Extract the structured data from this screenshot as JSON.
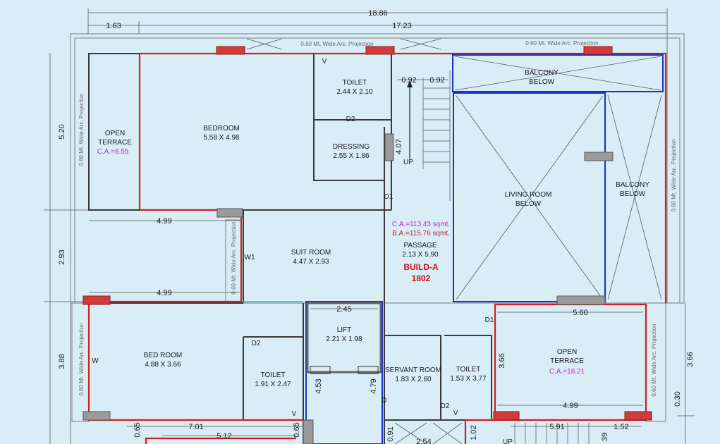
{
  "dimensions": {
    "overall_width": "18.86",
    "left_offset": "1.63",
    "inner_width": "17.23",
    "stair_a": "0.92",
    "stair_b": "0.92",
    "left_h1": "5.20",
    "left_h2": "2.93",
    "left_h3": "3.88",
    "bed_width_1": "4.99",
    "bed_width_2": "4.99",
    "lift_width": "2.45",
    "stair_run": "4.07",
    "right_width_1": "5.60",
    "right_h1": "3.66",
    "right_h2": "3.66",
    "right_width_2": "4.99",
    "right_h3": "0.30",
    "bottom_1": "0.65",
    "bottom_2": "7.01",
    "bottom_3": "5.12",
    "bottom_4": "0.65",
    "bottom_5": "4.53",
    "bottom_6": "4.79",
    "bottom_7": "0.91",
    "bottom_8": "2.54",
    "bottom_9": "1.02",
    "bottom_10": "5.91",
    "bottom_11": "1.52",
    "bottom_12": "39"
  },
  "projection_label": "0.60 Mt. Wide Arc. Projection",
  "rooms": {
    "open_terrace_1": {
      "line1": "OPEN",
      "line2": "TERRACE",
      "ca": "C.A.=8.55"
    },
    "bedroom": {
      "name": "BEDROOM",
      "size": "5.58 X 4.98"
    },
    "toilet_1": {
      "name": "TOILET",
      "size": "2.44 X 2.10"
    },
    "dressing": {
      "name": "DRESSING",
      "size": "2.55 X 1.86"
    },
    "balcony_top": {
      "line1": "BALCONY",
      "line2": "BELOW"
    },
    "living_room": {
      "line1": "LIVING ROOM",
      "line2": "BELOW"
    },
    "balcony_right": {
      "line1": "BALCONY",
      "line2": "BELOW"
    },
    "suit_room": {
      "name": "SUIT ROOM",
      "size": "4.47 X 2.93"
    },
    "passage": {
      "ca": "C.A.=113.43 sqmt.",
      "ba": "B.A.=115.76 sqmt.",
      "name": "PASSAGE",
      "size": "2.13 X 5.90"
    },
    "build": {
      "line1": "BUILD-A",
      "line2": "1802"
    },
    "bed_room": {
      "name": "BED ROOM",
      "size": "4.88 X 3.66"
    },
    "lift": {
      "name": "LIFT",
      "size": "2.21 X 1.98"
    },
    "toilet_2": {
      "name": "TOILET",
      "size": "1.91 X 2.47"
    },
    "servant_room": {
      "name": "SERVANT ROOM",
      "size": "1.83 X 2.60"
    },
    "toilet_3": {
      "name": "TOILET",
      "size": "1.53 X 3.77"
    },
    "open_terrace_2": {
      "line1": "OPEN",
      "line2": "TERRACE",
      "ca": "C.A.=18.21"
    }
  },
  "marks": {
    "v": "V",
    "d": "D",
    "d1": "D1",
    "d2": "D2",
    "w": "W",
    "w1": "W1",
    "up": "UP"
  }
}
